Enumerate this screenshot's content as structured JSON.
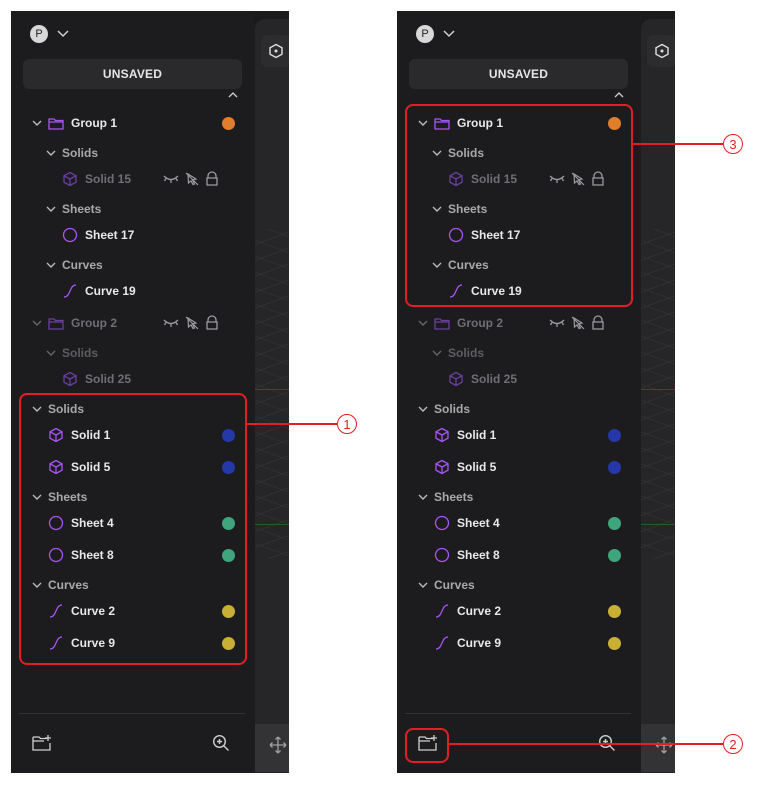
{
  "colors": {
    "accent_purple": "#9b59ff",
    "group_orange": "#e07e2c",
    "solid_blue": "#2438a8",
    "sheet_green": "#3fa57d",
    "curve_yellow": "#c9b035",
    "highlight_red": "#e31e24"
  },
  "panel": {
    "user_initial": "P",
    "unsaved_label": "UNSAVED",
    "group1": {
      "label": "Group 1",
      "solids": "Solids",
      "solid15": "Solid 15",
      "sheets": "Sheets",
      "sheet17": "Sheet 17",
      "curves": "Curves",
      "curve19": "Curve 19"
    },
    "group2": {
      "label": "Group 2",
      "solids": "Solids",
      "solid25": "Solid 25"
    },
    "root": {
      "solids": "Solids",
      "solid1": "Solid 1",
      "solid5": "Solid 5",
      "sheets": "Sheets",
      "sheet4": "Sheet 4",
      "sheet8": "Sheet 8",
      "curves": "Curves",
      "curve2": "Curve 2",
      "curve9": "Curve 9"
    }
  },
  "callouts": {
    "one": "1",
    "two": "2",
    "three": "3"
  }
}
